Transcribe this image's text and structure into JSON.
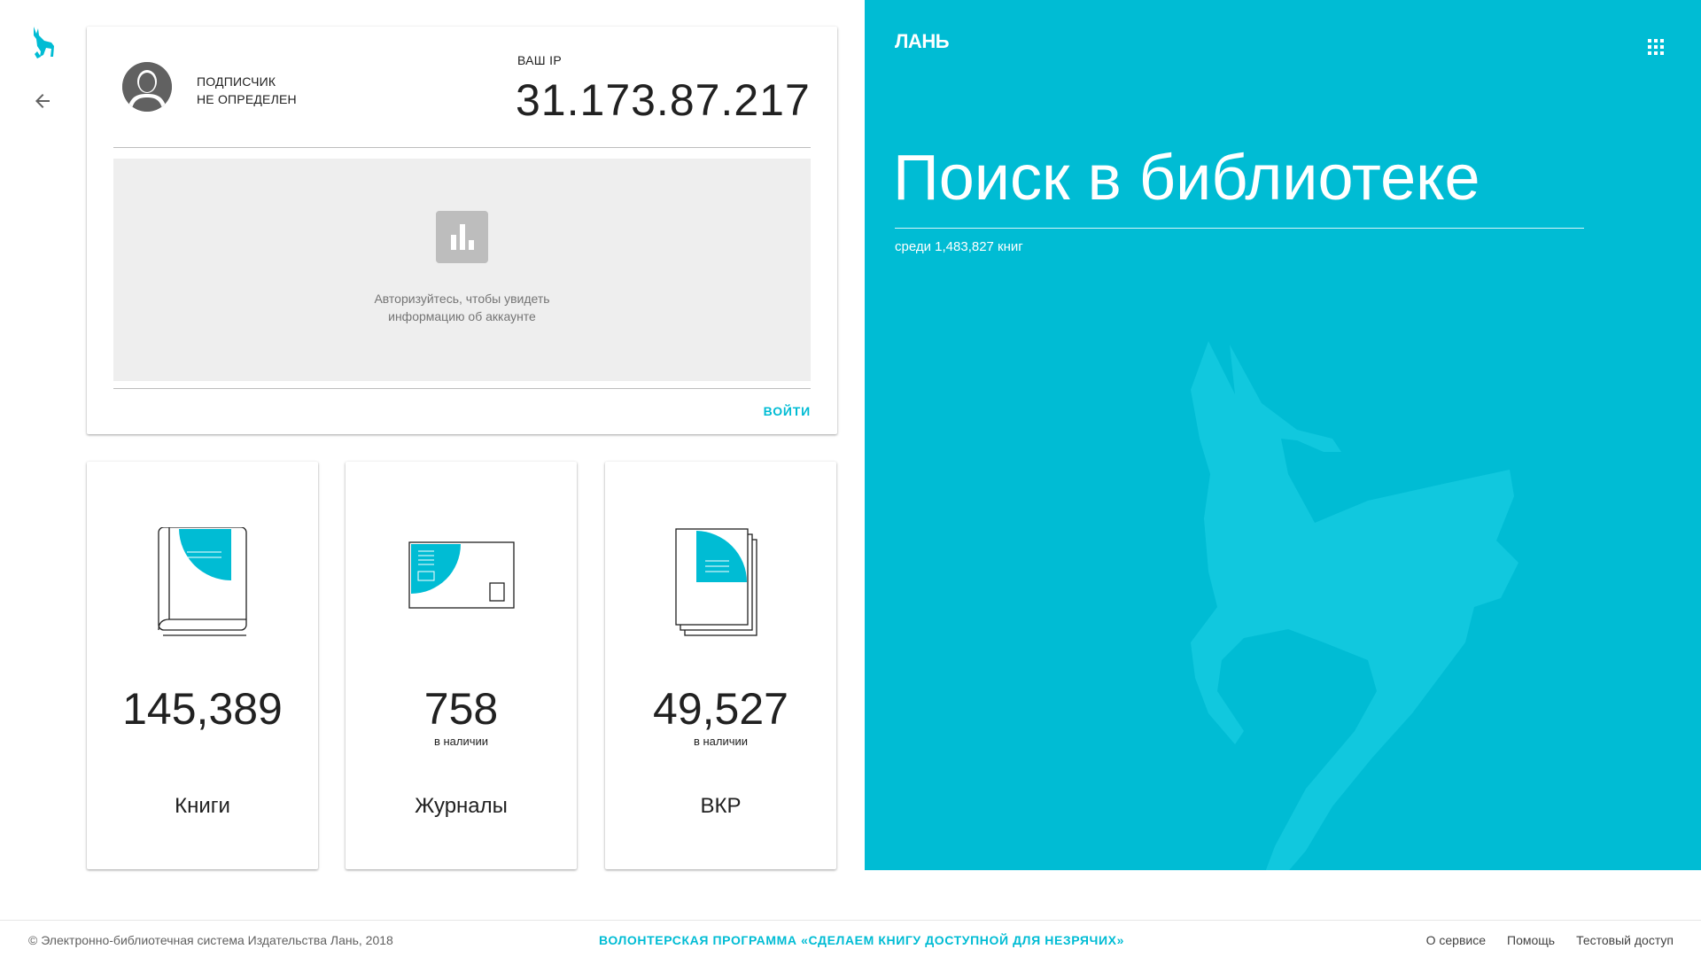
{
  "rail": {
    "logo_icon": "deer-logo-icon",
    "back_icon": "arrow-back-icon"
  },
  "account": {
    "subscriber_line1": "ПОДПИСЧИК",
    "subscriber_line2": "НЕ ОПРЕДЕЛЕН",
    "ip_label": "ВАШ IP",
    "ip_value": "31.173.87.217",
    "auth_line1": "Авторизуйтесь, чтобы увидеть",
    "auth_line2": "информацию об аккаунте",
    "login_label": "ВОЙТИ"
  },
  "stats": [
    {
      "number": "145,389",
      "availability": "",
      "title": "Книги",
      "icon": "book-icon"
    },
    {
      "number": "758",
      "availability": "в наличии",
      "title": "Журналы",
      "icon": "journal-icon"
    },
    {
      "number": "49,527",
      "availability": "в наличии",
      "title": "ВКР",
      "icon": "documents-icon"
    }
  ],
  "hero": {
    "brand": "ЛАНЬ",
    "apps_icon": "apps-grid-icon",
    "title": "Поиск в библиотеке",
    "count_text": "среди 1,483,827 книг",
    "background_color": "#00bcd4"
  },
  "footer": {
    "copyright": "© Электронно-библиотечная система Издательства Лань, 2018",
    "volunteer": "ВОЛОНТЕРСКАЯ ПРОГРАММА «СДЕЛАЕМ КНИГУ ДОСТУПНОЙ ДЛЯ НЕЗРЯЧИХ»",
    "links": [
      "О сервисе",
      "Помощь",
      "Тестовый доступ"
    ]
  },
  "colors": {
    "accent": "#00bcd4",
    "text": "#212121",
    "muted": "#757575"
  }
}
